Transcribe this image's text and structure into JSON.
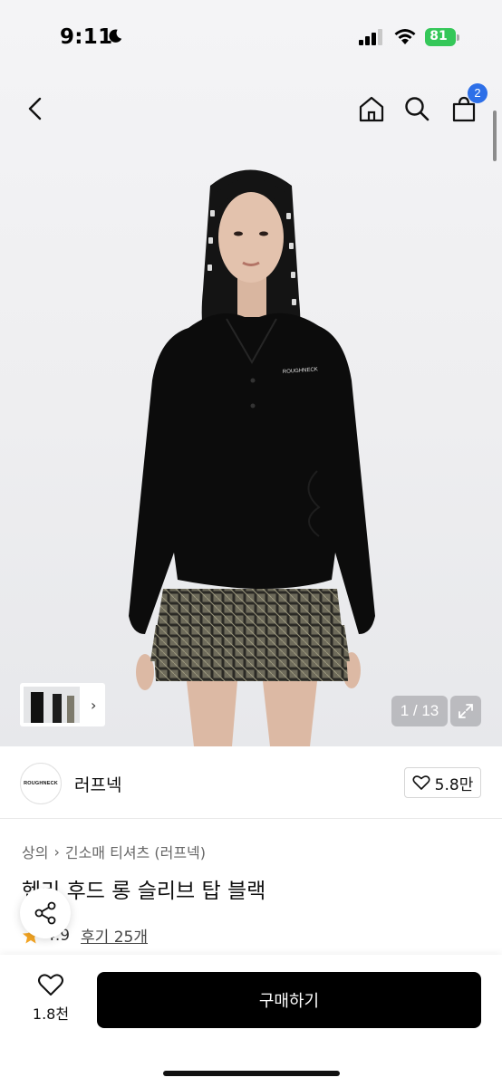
{
  "status_bar": {
    "time": "9:11",
    "battery": "81",
    "icons": [
      "moon-icon",
      "signal-icon",
      "wifi-icon",
      "battery-icon"
    ]
  },
  "nav": {
    "icons": [
      "back-icon",
      "home-icon",
      "search-icon",
      "cart-icon"
    ],
    "cart_count": "2"
  },
  "gallery": {
    "counter": "1 / 13",
    "thumb_chevron": "›",
    "icons": [
      "expand-icon",
      "chevron-right-icon"
    ]
  },
  "brand": {
    "logo_text": "ROUGHNECK",
    "name": "러프넥",
    "like_count": "5.8만"
  },
  "product": {
    "breadcrumb": [
      "상의",
      "긴소매 티셔츠 (러프넥)"
    ],
    "breadcrumb_sep": "›",
    "title": "헨리 후드 롱 슬리브 탑 블랙",
    "rating": "4.9",
    "review_label": "후기 25개",
    "shirt_print": "ROUGHNECK"
  },
  "bottom": {
    "like_count": "1.8천",
    "buy_label": "구매하기"
  },
  "colors": {
    "accent_badge": "#2d6fe8",
    "battery": "#35c759",
    "star": "#f5a623",
    "buy_button": "#000000"
  }
}
